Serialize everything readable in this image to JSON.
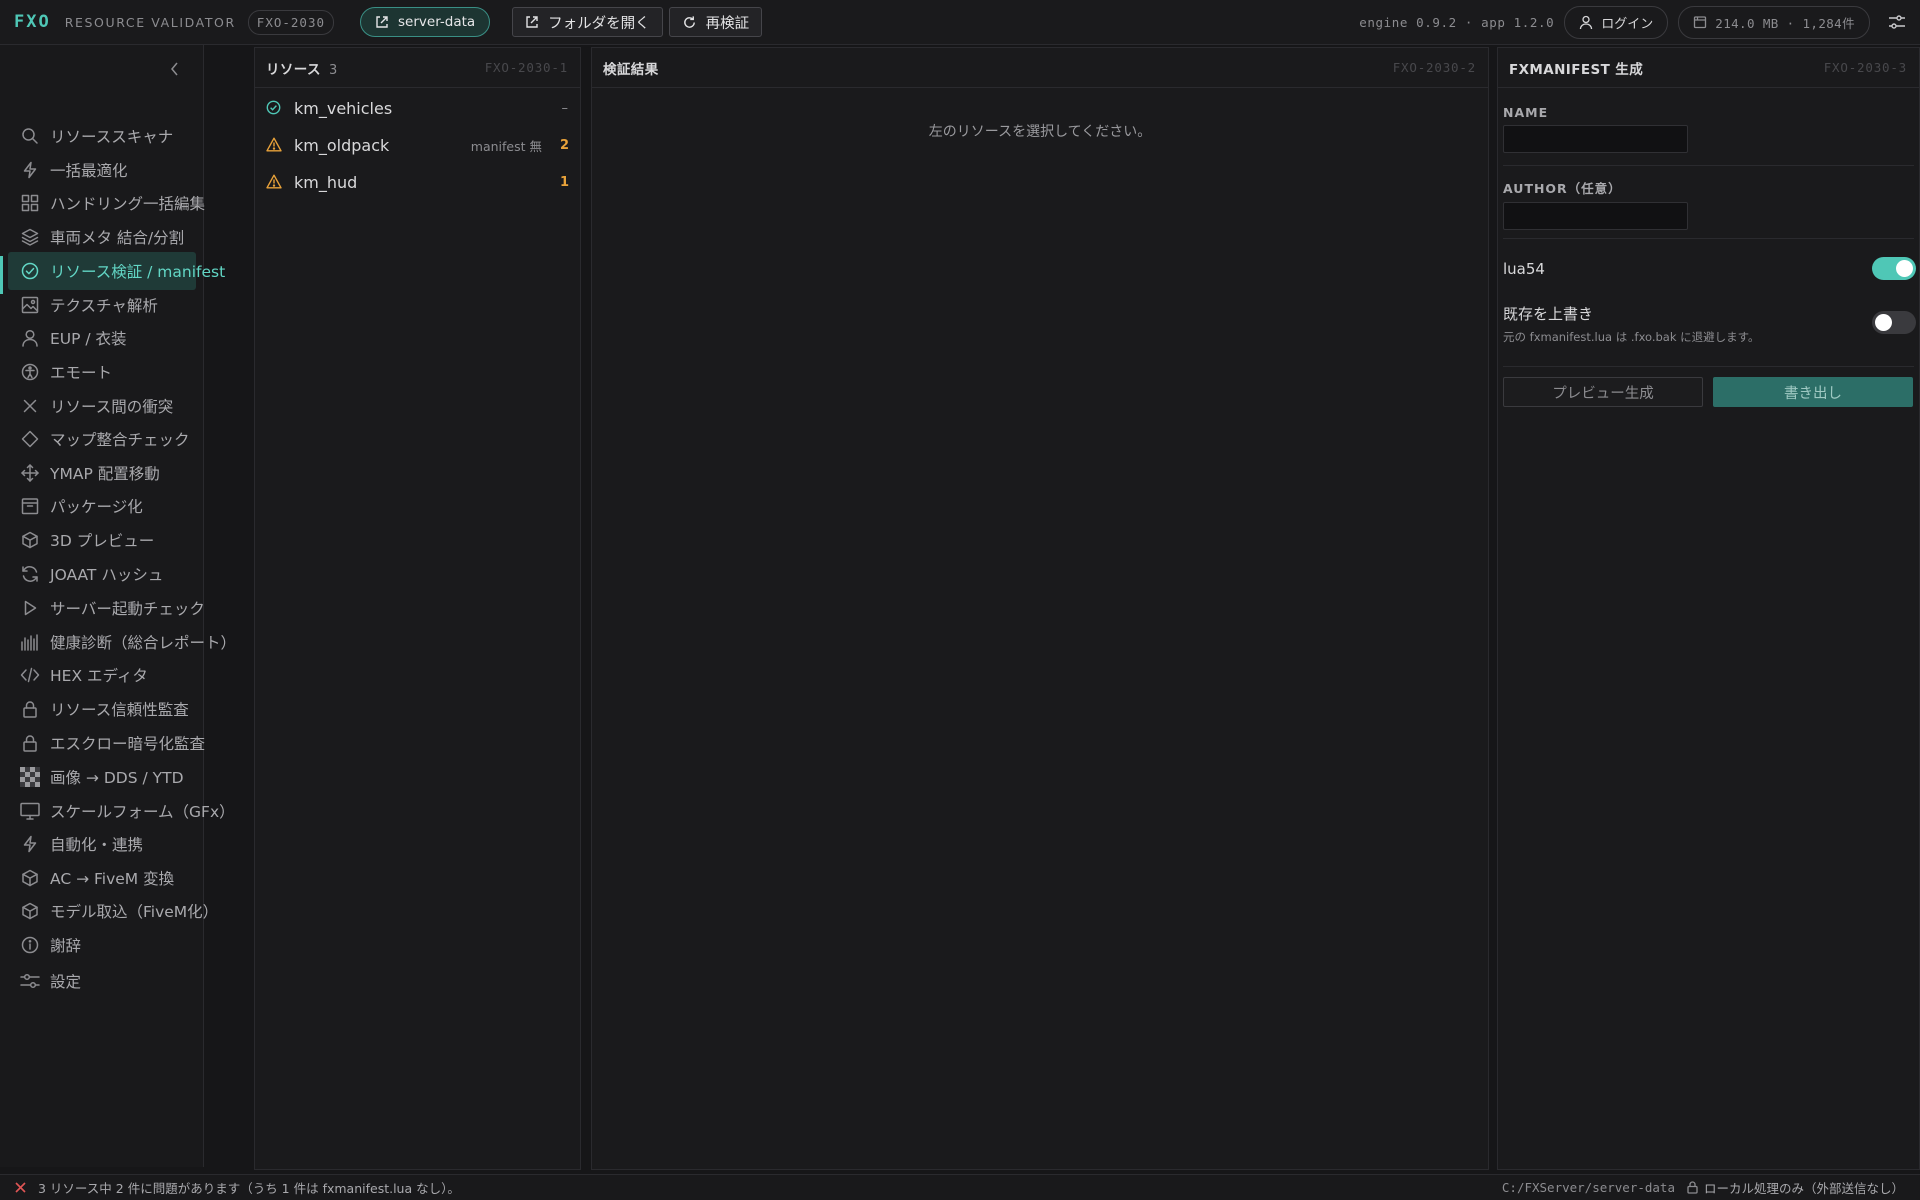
{
  "header": {
    "brand": "FXO",
    "subtitle": "RESOURCE VALIDATOR",
    "code": "FXO-2030",
    "server": "server-data",
    "open_folder": "フォルダを開く",
    "revalidate": "再検証",
    "engine": "engine 0.9.2 · app 1.2.0",
    "login": "ログイン",
    "stats": "214.0 MB · 1,284件"
  },
  "sidebar": {
    "items": [
      {
        "label": "リソーススキャナ",
        "icon": "search-icon"
      },
      {
        "label": "一括最適化",
        "icon": "bolt-icon"
      },
      {
        "label": "ハンドリング一括編集",
        "icon": "grid-icon"
      },
      {
        "label": "車両メタ 結合/分割",
        "icon": "layers-icon"
      },
      {
        "label": "リソース検証 / manifest",
        "icon": "check-circle-icon"
      },
      {
        "label": "テクスチャ解析",
        "icon": "image-icon"
      },
      {
        "label": "EUP / 衣装",
        "icon": "user-icon"
      },
      {
        "label": "エモート",
        "icon": "accessibility-icon"
      },
      {
        "label": "リソース間の衝突",
        "icon": "x-icon"
      },
      {
        "label": "マップ整合チェック",
        "icon": "diamond-icon"
      },
      {
        "label": "YMAP 配置移動",
        "icon": "move-icon"
      },
      {
        "label": "パッケージ化",
        "icon": "archive-icon"
      },
      {
        "label": "3D プレビュー",
        "icon": "cube-icon"
      },
      {
        "label": "JOAAT ハッシュ",
        "icon": "refresh-icon"
      },
      {
        "label": "サーバー起動チェック",
        "icon": "play-icon"
      },
      {
        "label": "健康診断（総合レポート）",
        "icon": "bars-icon"
      },
      {
        "label": "HEX エディタ",
        "icon": "code-icon"
      },
      {
        "label": "リソース信頼性監査",
        "icon": "lock-icon"
      },
      {
        "label": "エスクロー暗号化監査",
        "icon": "lock-icon"
      },
      {
        "label": "画像 → DDS / YTD",
        "icon": "checker-icon"
      },
      {
        "label": "スケールフォーム（GFx）",
        "icon": "monitor-icon"
      },
      {
        "label": "自動化・連携",
        "icon": "bolt-icon"
      },
      {
        "label": "AC → FiveM 変換",
        "icon": "cube-icon"
      },
      {
        "label": "モデル取込（FiveM化）",
        "icon": "cube-icon"
      },
      {
        "label": "謝辞",
        "icon": "info-icon"
      },
      {
        "label": "設定",
        "icon": "sliders-icon"
      }
    ]
  },
  "resources_panel": {
    "title": "リソース",
    "count": "3",
    "code": "FXO-2030-1",
    "items": [
      {
        "name": "km_vehicles",
        "note": "",
        "issues": "–",
        "status": "ok"
      },
      {
        "name": "km_oldpack",
        "note": "manifest 無",
        "issues": "2",
        "status": "warn"
      },
      {
        "name": "km_hud",
        "note": "",
        "issues": "1",
        "status": "warn"
      }
    ]
  },
  "results_panel": {
    "title": "検証結果",
    "code": "FXO-2030-2",
    "placeholder": "左のリソースを選択してください。"
  },
  "manifest_panel": {
    "title": "FXMANIFEST 生成",
    "code": "FXO-2030-3",
    "name_label": "NAME",
    "author_label": "AUTHOR（任意）",
    "lua54_label": "lua54",
    "lua54_on": true,
    "overwrite_label": "既存を上書き",
    "overwrite_hint": "元の fxmanifest.lua は .fxo.bak に退避します。",
    "overwrite_on": false,
    "preview_button": "プレビュー生成",
    "export_button": "書き出し"
  },
  "status": {
    "message": "3 リソース中 2 件に問題があります（うち 1 件は fxmanifest.lua なし）。",
    "path": "C:/FXServer/server-data",
    "privacy": "ローカル処理のみ（外部送信なし）"
  },
  "colors": {
    "accent": "#4fc7b6",
    "warning": "#e8a23a",
    "error": "#e05555"
  }
}
